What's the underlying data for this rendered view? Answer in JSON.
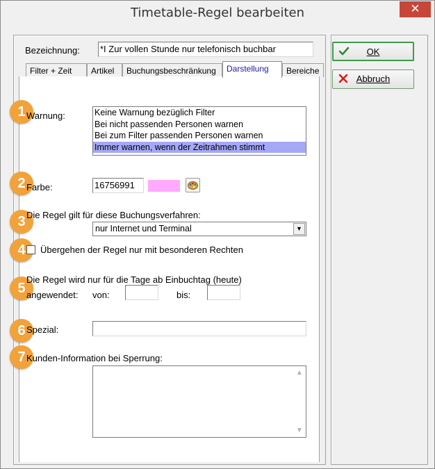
{
  "window": {
    "title": "Timetable-Regel bearbeiten",
    "close_glyph": "✕"
  },
  "header": {
    "bezeichnung_label": "Bezeichnung:",
    "bezeichnung_value": "*I Zur vollen Stunde nur telefonisch buchbar"
  },
  "tabs": [
    {
      "label": "Filter + Zeit",
      "active": false
    },
    {
      "label": "Artikel",
      "active": false
    },
    {
      "label": "Buchungsbeschränkung",
      "active": false
    },
    {
      "label": "Darstellung",
      "active": true
    },
    {
      "label": "Bereiche",
      "active": false
    }
  ],
  "badges": [
    "1",
    "2",
    "3",
    "4",
    "5",
    "6",
    "7"
  ],
  "warnung": {
    "label": "Warnung:",
    "options": [
      "Keine Warnung bezüglich Filter",
      "Bei nicht passenden Personen warnen",
      "Bei zum Filter passenden Personen warnen",
      "Immer warnen, wenn der Zeitrahmen stimmt"
    ],
    "selected_index": 3
  },
  "farbe": {
    "label": "Farbe:",
    "value": "16756991",
    "swatch_color": "#ffaaff",
    "icon": "palette-icon"
  },
  "buchungsverfahren": {
    "label": "Die Regel gilt für diese Buchungsverfahren:",
    "selected": "nur Internet und Terminal"
  },
  "override": {
    "label": "Übergehen der Regel nur mit besonderen Rechten",
    "checked": false
  },
  "tage": {
    "line1": "Die Regel wird nur für die Tage ab Einbuchtag (heute)",
    "line2": "angewendet:",
    "von_label": "von:",
    "von_value": "",
    "bis_label": "bis:",
    "bis_value": ""
  },
  "spezial": {
    "label": "Spezial:",
    "value": ""
  },
  "kunden_info": {
    "label": "Kunden-Information bei Sperrung:",
    "value": ""
  },
  "buttons": {
    "ok": {
      "label": "OK",
      "icon": "checkmark-icon",
      "icon_color": "#2e8b2e"
    },
    "abbruch": {
      "label": "Abbruch",
      "icon": "cross-icon",
      "icon_color": "#d21f1f"
    }
  },
  "colors": {
    "badge": "#f2a23a",
    "active_tab_text": "#1a1aa8",
    "selection": "#a5a8f5"
  }
}
